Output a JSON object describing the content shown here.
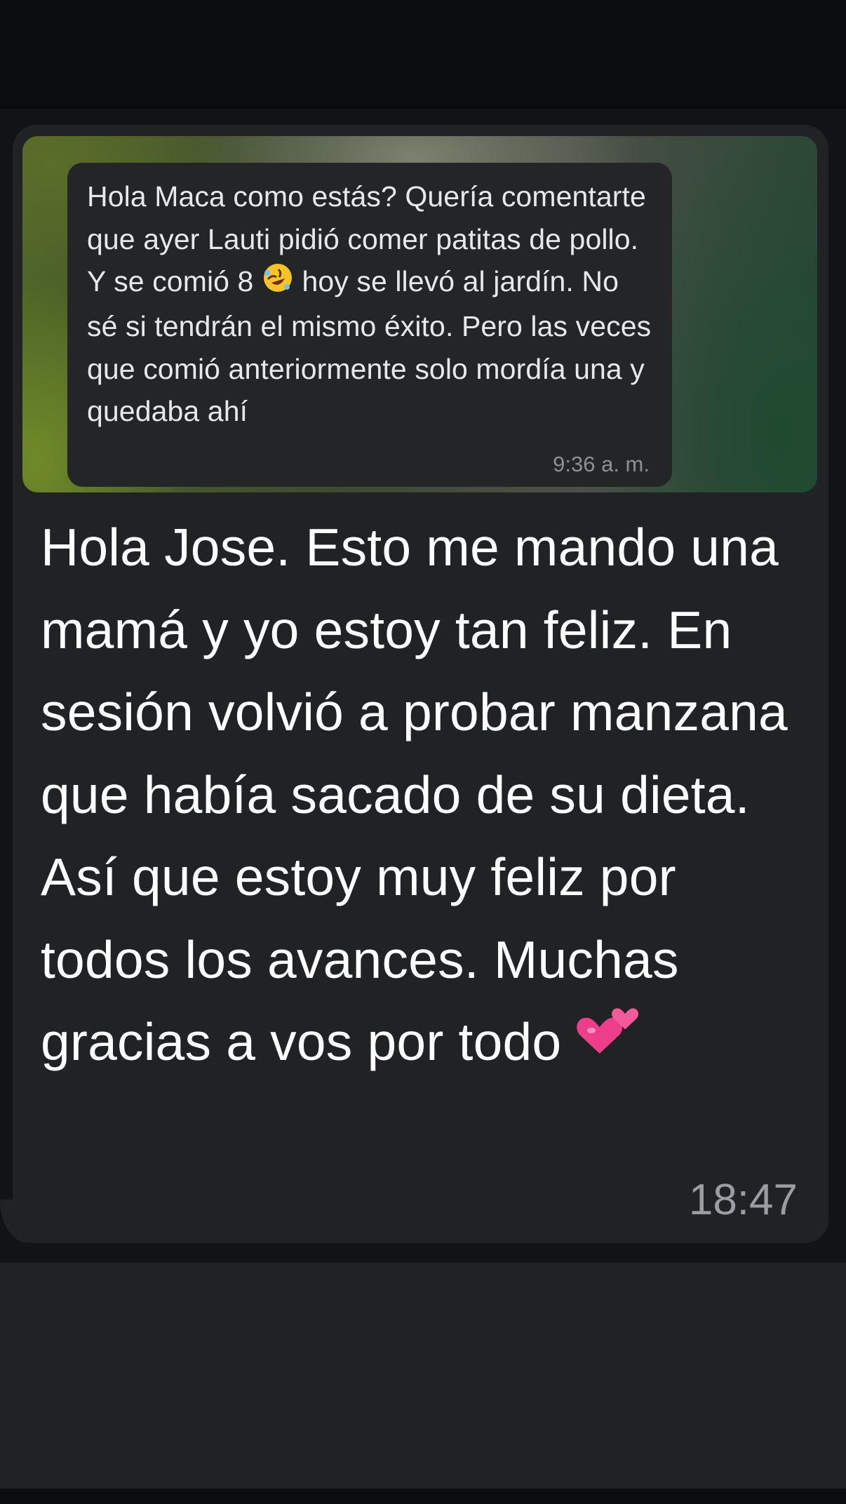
{
  "conversation": {
    "quoted_message": {
      "text_before_emoji": "Hola Maca como estás? Quería comentarte que ayer Lauti pidió comer patitas de pollo. Y se comió 8 ",
      "emoji_icon": "rolling-on-floor-laughing-emoji",
      "text_after_emoji": " hoy se llevó al jardín. No sé si tendrán el mismo éxito. Pero las veces que comió anteriormente solo mordía una y quedaba ahí",
      "time": "9:36 a. m."
    },
    "reply_message": {
      "text": "Hola Jose. Esto me mando una mamá y yo estoy tan feliz. En sesión volvió a probar manzana que había sacado de su dieta. Así que estoy muy feliz por todos los avances. Muchas gracias a vos por todo ",
      "emoji_icon": "two-hearts-emoji",
      "time": "18:47"
    }
  },
  "colors": {
    "bubble_background": "#202224",
    "chat_background": "#111314",
    "text_primary": "#ffffff",
    "timestamp": "#9a9ea2"
  }
}
